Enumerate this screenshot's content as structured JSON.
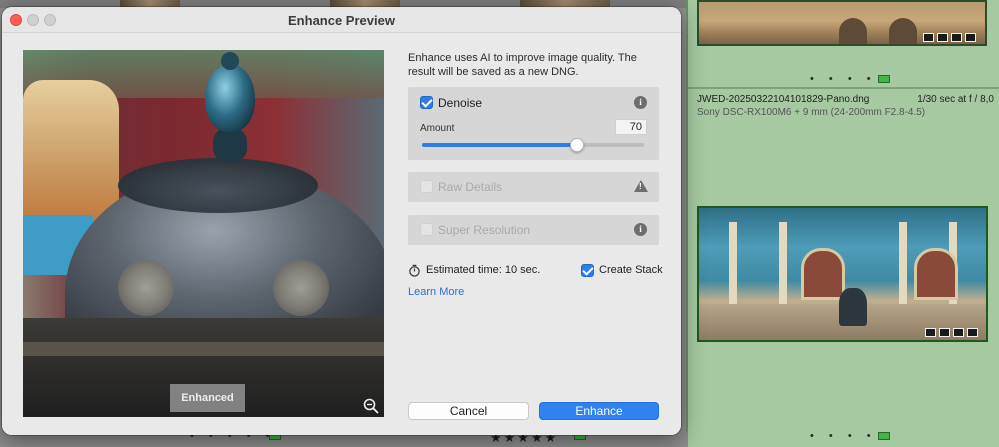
{
  "dialog": {
    "title": "Enhance Preview",
    "description": "Enhance uses AI to improve image quality. The result will be saved as a new DNG.",
    "preview_chip": "Enhanced",
    "denoise": {
      "label": "Denoise",
      "checked": true,
      "amount_label": "Amount",
      "amount_value": "70",
      "amount_fraction": 0.7
    },
    "raw_details": {
      "label": "Raw Details",
      "checked": false,
      "enabled": false
    },
    "super_resolution": {
      "label": "Super Resolution",
      "checked": false,
      "enabled": false
    },
    "estimated_time": "Estimated time: 10 sec.",
    "create_stack": {
      "label": "Create Stack",
      "checked": true
    },
    "learn_more": "Learn More",
    "buttons": {
      "cancel": "Cancel",
      "enhance": "Enhance"
    }
  },
  "library": {
    "filename": "JWED-20250322104101829-Pano.dng",
    "exposure": "1/30 sec at f / 8,0",
    "camera": "Sony DSC-RX100M6 + 9 mm (24-200mm F2.8-4.5)",
    "dots": "• • • • •",
    "stars": "★★★★★"
  },
  "colors": {
    "accent": "#2f82ef",
    "close_button": "#fe5f57",
    "flag_green": "#45b34a",
    "selected_cell": "#a6c9a1"
  }
}
